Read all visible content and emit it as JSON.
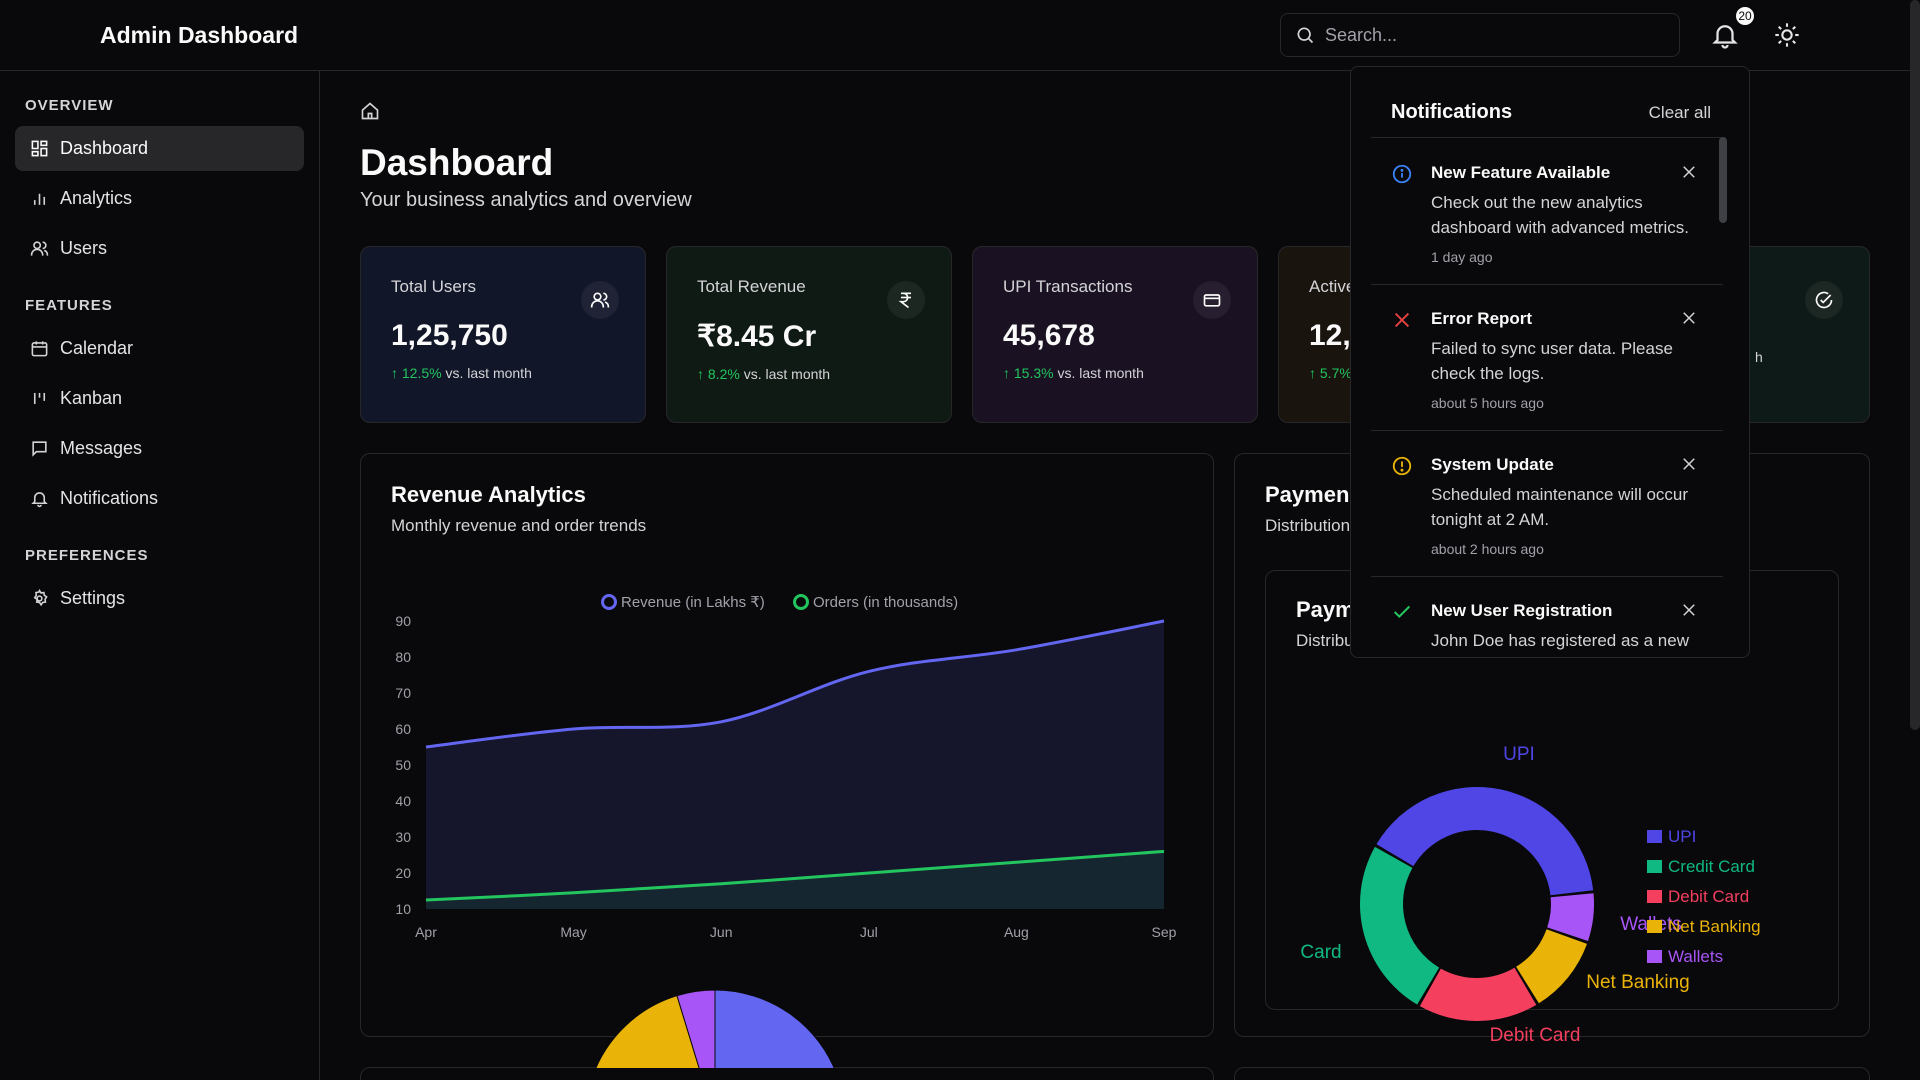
{
  "header": {
    "title": "Admin Dashboard",
    "search_placeholder": "Search...",
    "notification_count": "20"
  },
  "sidebar": {
    "sections": [
      {
        "label": "OVERVIEW",
        "items": [
          {
            "label": "Dashboard",
            "icon": "dashboard-icon",
            "active": true
          },
          {
            "label": "Analytics",
            "icon": "analytics-icon"
          },
          {
            "label": "Users",
            "icon": "users-icon"
          }
        ]
      },
      {
        "label": "FEATURES",
        "items": [
          {
            "label": "Calendar",
            "icon": "calendar-icon"
          },
          {
            "label": "Kanban",
            "icon": "kanban-icon"
          },
          {
            "label": "Messages",
            "icon": "messages-icon"
          },
          {
            "label": "Notifications",
            "icon": "bell-icon"
          }
        ]
      },
      {
        "label": "PREFERENCES",
        "items": [
          {
            "label": "Settings",
            "icon": "gear-icon"
          }
        ]
      }
    ]
  },
  "page": {
    "title": "Dashboard",
    "subtitle": "Your business analytics and overview"
  },
  "stats": [
    {
      "label": "Total Users",
      "value": "1,25,750",
      "change": "12.5%",
      "suffix": "vs. last month",
      "icon": "users-icon",
      "bg": "#121629"
    },
    {
      "label": "Total Revenue",
      "value": "₹8.45 Cr",
      "change": "8.2%",
      "suffix": "vs. last month",
      "icon": "rupee-icon",
      "bg": "#0f1a14"
    },
    {
      "label": "UPI Transactions",
      "value": "45,678",
      "change": "15.3%",
      "suffix": "vs. last month",
      "icon": "card-icon",
      "bg": "#1a1222"
    },
    {
      "label": "Active",
      "value": "12,",
      "change": "5.7%",
      "suffix": "",
      "icon": "",
      "bg": "#1a140e"
    },
    {
      "label": "",
      "value": "",
      "change": "",
      "suffix": "h",
      "icon": "check-circle-icon",
      "bg": "#0e1a17"
    }
  ],
  "revenue_panel": {
    "title": "Revenue Analytics",
    "subtitle": "Monthly revenue and order trends"
  },
  "payment_panel": {
    "title": "Paymen",
    "subtitle": "Distribution",
    "inner_title": "Paym",
    "inner_subtitle": "Distribu"
  },
  "notifications": {
    "title": "Notifications",
    "clear_label": "Clear all",
    "items": [
      {
        "type": "info",
        "icon": "info-icon",
        "title": "New Feature Available",
        "message": "Check out the new analytics dashboard with advanced metrics.",
        "time": "1 day ago"
      },
      {
        "type": "error",
        "icon": "x-icon",
        "title": "Error Report",
        "message": "Failed to sync user data. Please check the logs.",
        "time": "about 5 hours ago"
      },
      {
        "type": "warning",
        "icon": "alert-circle-icon",
        "title": "System Update",
        "message": "Scheduled maintenance will occur tonight at 2 AM.",
        "time": "about 2 hours ago"
      },
      {
        "type": "success",
        "icon": "check-icon",
        "title": "New User Registration",
        "message": "John Doe has registered as a new",
        "time": ""
      }
    ]
  },
  "colors": {
    "revenue": "#6366f1",
    "orders": "#22c55e",
    "upi": "#4f46e5",
    "credit": "#10b981",
    "debit": "#f43f5e",
    "netbanking": "#eab308",
    "wallets": "#a855f7"
  },
  "chart_data": [
    {
      "type": "area",
      "legend": [
        "Revenue (in Lakhs ₹)",
        "Orders (in thousands)"
      ],
      "categories": [
        "Apr",
        "May",
        "Jun",
        "Jul",
        "Aug",
        "Sep"
      ],
      "series": [
        {
          "name": "Revenue (in Lakhs ₹)",
          "values": [
            55,
            60,
            62,
            76,
            82,
            90
          ]
        },
        {
          "name": "Orders (in thousands)",
          "values": [
            12.5,
            14.5,
            17,
            20,
            23,
            26
          ]
        }
      ],
      "yticks": [
        10,
        20,
        30,
        40,
        50,
        60,
        70,
        80,
        90
      ],
      "ylim": [
        10,
        90
      ],
      "legend_position": "top",
      "grid": false
    },
    {
      "type": "pie",
      "donut": true,
      "categories": [
        "UPI",
        "Credit Card",
        "Debit Card",
        "Net Banking",
        "Wallets"
      ],
      "values": [
        40,
        25,
        17,
        11,
        7
      ],
      "outer_labels": [
        "UPI",
        "Card",
        "Debit Card",
        "Net Banking",
        "Wallets"
      ],
      "legend_position": "right"
    }
  ]
}
